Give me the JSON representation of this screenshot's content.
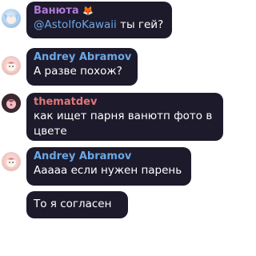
{
  "colors": {
    "bubble": "#1d1a2b",
    "sender_vanyuta": "#b07bd8",
    "sender_andrey": "#6aa8e6",
    "sender_thematdev": "#e07878",
    "mention": "#6ea8e6"
  },
  "messages": [
    {
      "sender": "Ванюта",
      "sender_badge": "🦊",
      "mention": "@AstolfoKawaii",
      "text": " ты гей?",
      "avatar_icon": "anime-avatar-blue"
    },
    {
      "sender": "Andrey Abramov",
      "text": "А разве похож?",
      "avatar_icon": "anime-avatar-pink"
    },
    {
      "sender": "thematdev",
      "text_line1": "как ищет парня ванютп фото в",
      "text_line2": "цвете",
      "avatar_icon": "anime-avatar-dark"
    },
    {
      "sender": "Andrey Abramov",
      "text": "Ааааа если нужен парень",
      "avatar_icon": "anime-avatar-pink"
    },
    {
      "text": "То я согласен"
    }
  ]
}
